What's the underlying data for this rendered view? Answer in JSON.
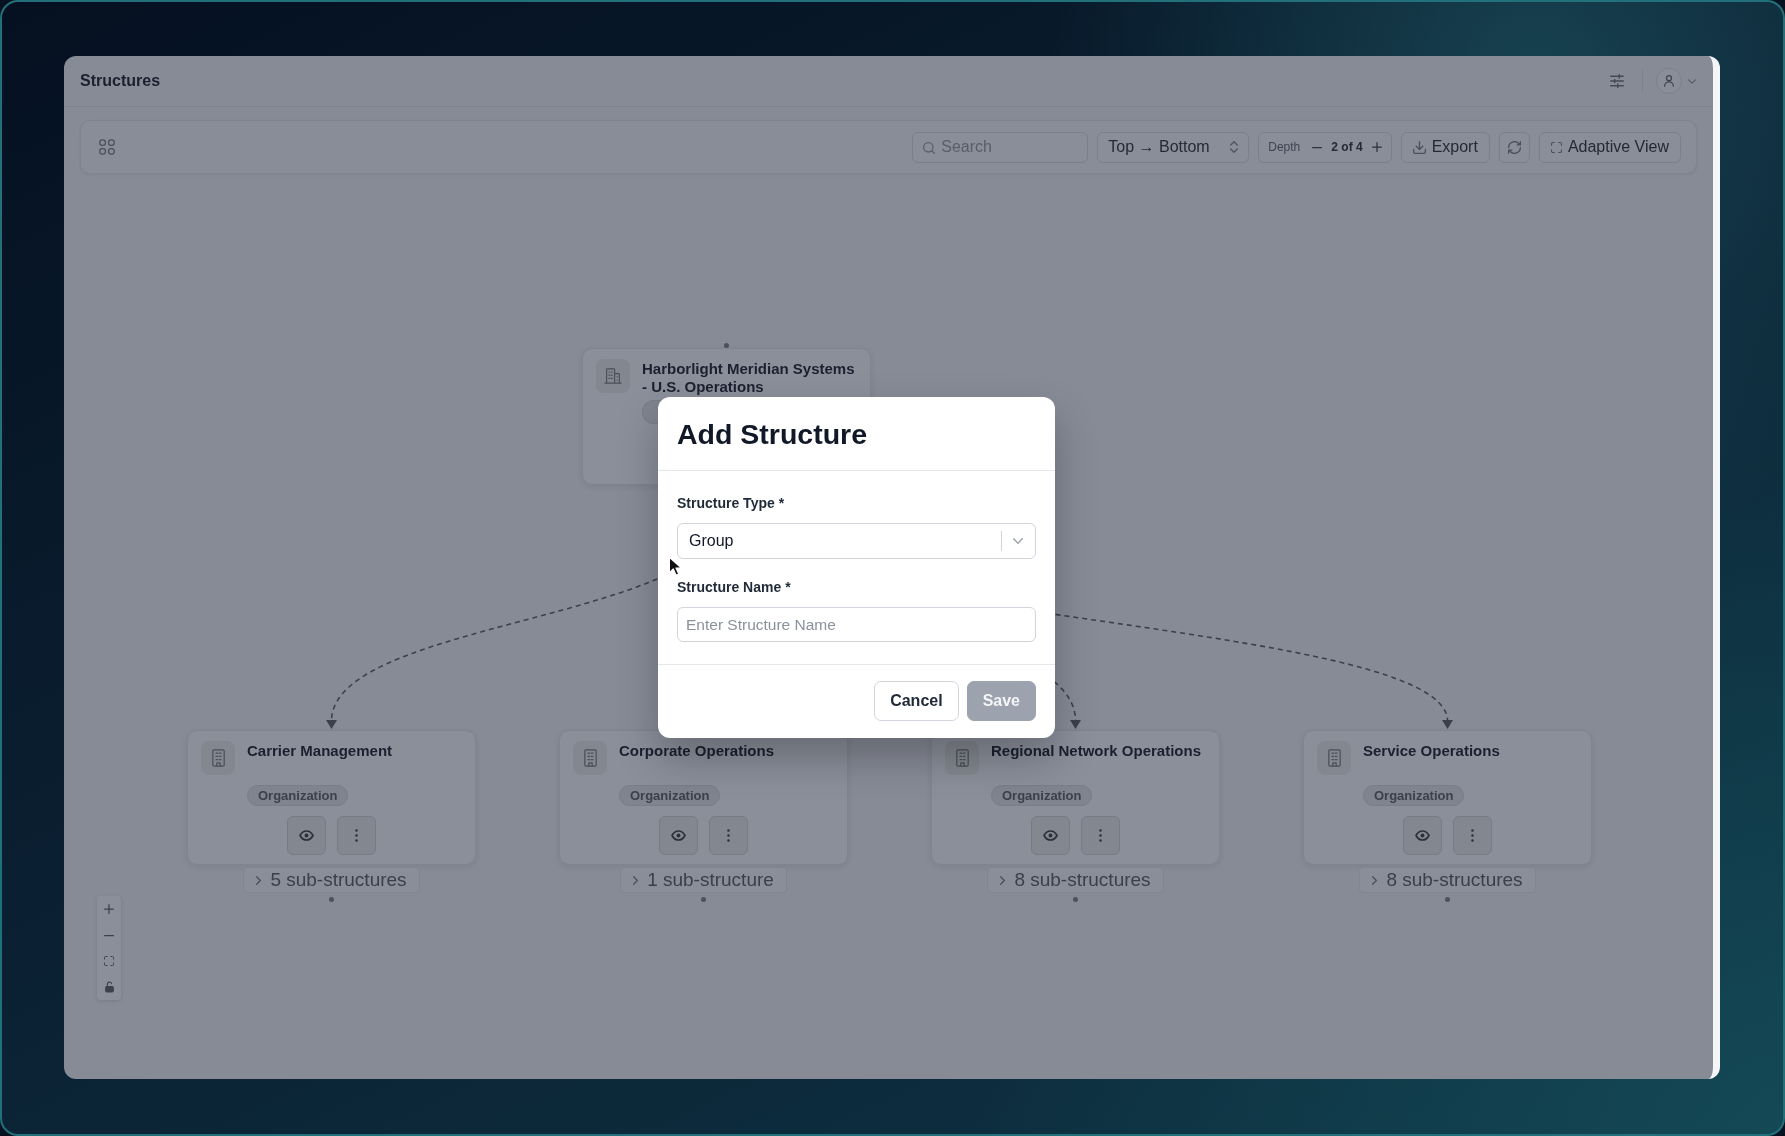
{
  "header": {
    "title": "Structures"
  },
  "toolbar": {
    "search": {
      "placeholder": "Search"
    },
    "direction": {
      "value": "Top → Bottom"
    },
    "depth": {
      "label": "Depth",
      "value": "2 of 4"
    },
    "export_button": {
      "label": "Export"
    },
    "adaptive_view_button": {
      "label": "Adaptive View"
    }
  },
  "tree": {
    "title": "Harborlight Meridian Systems - U.S. Operations",
    "children": [
      {
        "title": "Carrier Management",
        "tag": "Organization",
        "subtree_label": "5 sub-structures"
      },
      {
        "title": "Corporate Operations",
        "tag": "Organization",
        "subtree_label": "1 sub-structure"
      },
      {
        "title": "Regional Network Operations",
        "tag": "Organization",
        "subtree_label": "8 sub-structures"
      },
      {
        "title": "Service Operations",
        "tag": "Organization",
        "subtree_label": "8 sub-structures"
      }
    ]
  },
  "dialog": {
    "title": "Add Structure",
    "fields": [
      {
        "kind": "select",
        "label": "Structure Type *",
        "value": "Group"
      },
      {
        "kind": "text",
        "label": "Structure Name *",
        "placeholder": "Enter Structure Name"
      }
    ],
    "buttons": [
      {
        "kind": "secondary",
        "label": "Cancel",
        "disabled": false
      },
      {
        "kind": "primary",
        "label": "Save",
        "disabled": true
      }
    ]
  }
}
